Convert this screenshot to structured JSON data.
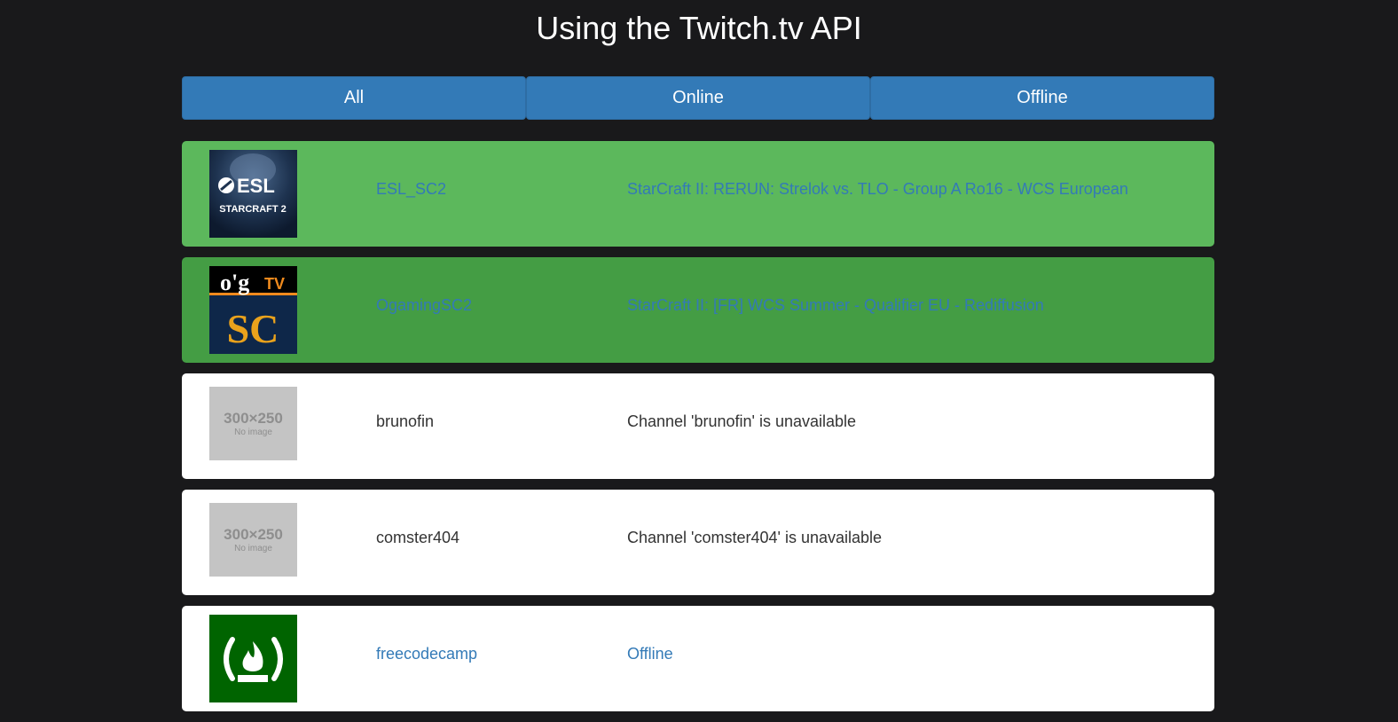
{
  "header": {
    "title": "Using the Twitch.tv API"
  },
  "filters": [
    {
      "label": "All"
    },
    {
      "label": "Online"
    },
    {
      "label": "Offline"
    }
  ],
  "streams": [
    {
      "name": "ESL_SC2",
      "status": "StarCraft II: RERUN: Strelok vs. TLO - Group A Ro16 - WCS European",
      "state": "online",
      "logo_text": {
        "brand": "ESL",
        "game": "STARCRAFT 2"
      },
      "logo_colors": {
        "bg": "#1e3350",
        "text": "#ffffff"
      }
    },
    {
      "name": "OgamingSC2",
      "status": "StarCraft II: [FR] WCS Summer - Qualifier EU - Rediffusion",
      "state": "online",
      "logo_text": {
        "brand": "o'g",
        "tv": "TV",
        "game": "SC"
      },
      "logo_colors": {
        "top": "#000000",
        "bottom": "#0e2749",
        "accent": "#f08a1d",
        "gold": "#e9a21c"
      }
    },
    {
      "name": "brunofin",
      "status": "Channel 'brunofin' is unavailable",
      "state": "unavailable",
      "placeholder": {
        "size": "300×250",
        "note": "No image"
      }
    },
    {
      "name": "comster404",
      "status": "Channel 'comster404' is unavailable",
      "state": "unavailable",
      "placeholder": {
        "size": "300×250",
        "note": "No image"
      }
    },
    {
      "name": "freecodecamp",
      "status": "Offline",
      "state": "offline",
      "logo_colors": {
        "bg": "#006400",
        "fg": "#ffffff"
      }
    }
  ],
  "colors": {
    "page_bg": "#19191b",
    "button": "#337ab7",
    "online_row": "#5cb85c",
    "online_row_alt": "#449d44",
    "offline_row": "#ffffff",
    "link": "#337ab7",
    "text": "#333333"
  }
}
